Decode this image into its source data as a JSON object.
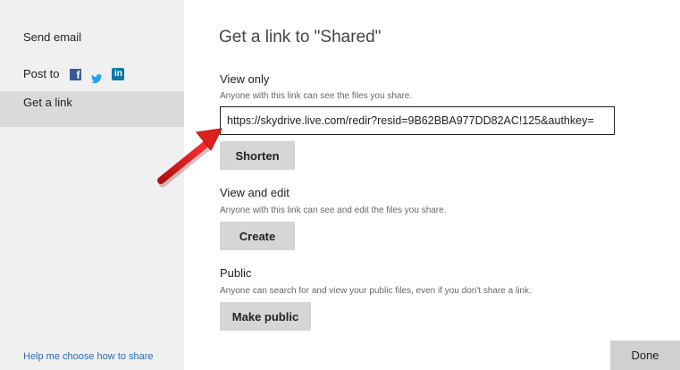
{
  "sidebar": {
    "send_email": "Send email",
    "post_to": "Post to",
    "get_link": "Get a link",
    "help_link": "Help me choose how to share",
    "social_icons": [
      "facebook-icon",
      "twitter-icon",
      "linkedin-icon"
    ]
  },
  "main": {
    "title": "Get a link to \"Shared\"",
    "view_only": {
      "title": "View only",
      "description": "Anyone with this link can see the files you share.",
      "link_value": "https://skydrive.live.com/redir?resid=9B62BBA977DD82AC!125&authkey=",
      "button_label": "Shorten"
    },
    "view_edit": {
      "title": "View and edit",
      "description": "Anyone with this link can see and edit the files you share.",
      "button_label": "Create"
    },
    "public": {
      "title": "Public",
      "description": "Anyone can search for and view your public files, even if you don't share a link.",
      "button_label": "Make public"
    }
  },
  "footer": {
    "done_label": "Done"
  },
  "colors": {
    "sidebar_bg": "#f0f0f0",
    "sidebar_selected": "#dadada",
    "button_bg": "#d6d6d6",
    "link_color": "#2b6bb3",
    "annotation_arrow": "#e02020",
    "facebook": "#3b5998",
    "twitter": "#1da1f2",
    "linkedin": "#0e76a8"
  }
}
